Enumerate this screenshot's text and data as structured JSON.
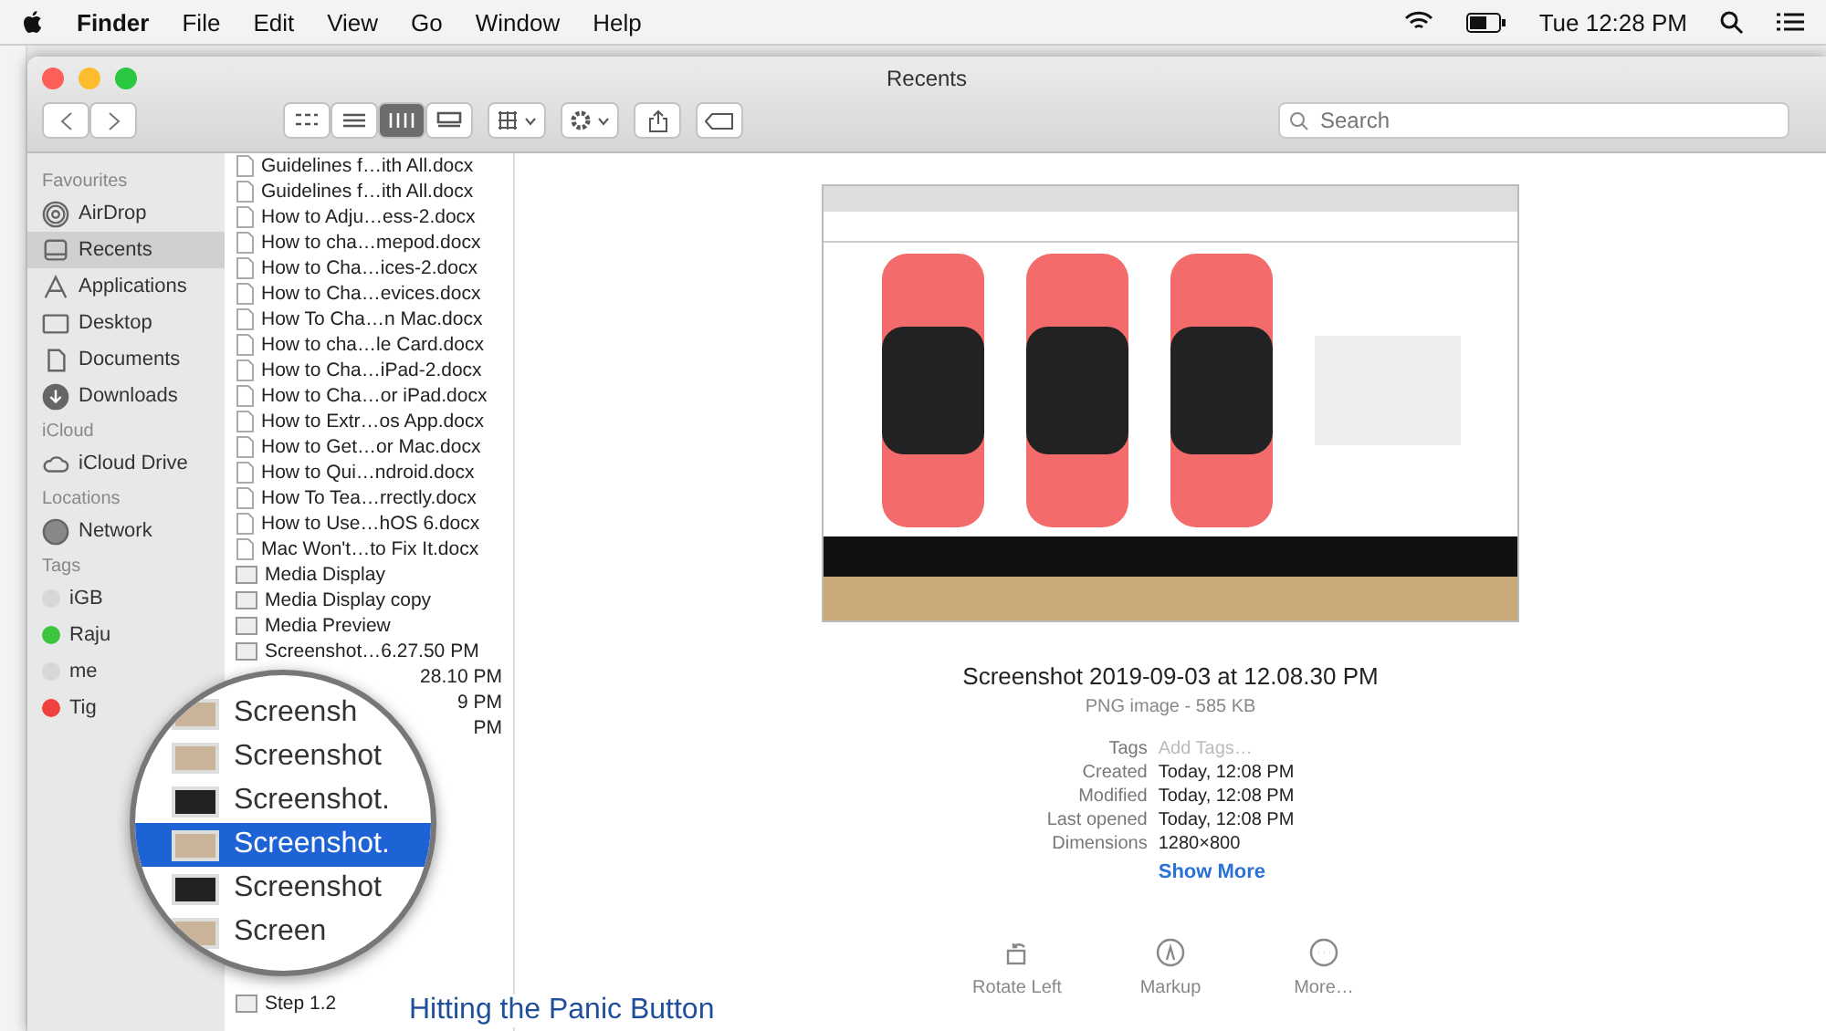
{
  "menubar": {
    "app": "Finder",
    "menus": [
      "File",
      "Edit",
      "View",
      "Go",
      "Window",
      "Help"
    ],
    "clock": "Tue 12:28 PM"
  },
  "window": {
    "title": "Recents",
    "search": {
      "placeholder": "Search"
    },
    "view_modes": [
      {
        "selected": false
      },
      {
        "selected": false
      },
      {
        "selected": true
      },
      {
        "selected": false
      }
    ]
  },
  "sidebar": [
    {
      "heading": "Favourites",
      "items": [
        {
          "label": "AirDrop",
          "kind": "airdrop",
          "selected": false
        },
        {
          "label": "Recents",
          "kind": "recents",
          "selected": true
        },
        {
          "label": "Applications",
          "kind": "apps",
          "selected": false
        },
        {
          "label": "Desktop",
          "kind": "desktop",
          "selected": false
        },
        {
          "label": "Documents",
          "kind": "documents",
          "selected": false
        },
        {
          "label": "Downloads",
          "kind": "downloads",
          "selected": false
        }
      ]
    },
    {
      "heading": "iCloud",
      "items": [
        {
          "label": "iCloud Drive",
          "kind": "cloud",
          "selected": false
        }
      ]
    },
    {
      "heading": "Locations",
      "items": [
        {
          "label": "Network",
          "kind": "network",
          "selected": false
        }
      ]
    },
    {
      "heading": "Tags",
      "items": [
        {
          "label": "iGB",
          "kind": "tag",
          "color": "#d8d8d8",
          "selected": false
        },
        {
          "label": "Raju",
          "kind": "tag",
          "color": "#3ec53e",
          "selected": false
        },
        {
          "label": "me",
          "kind": "tag",
          "color": "#d8d8d8",
          "selected": false
        },
        {
          "label": "Tig",
          "kind": "tag",
          "color": "#f04040",
          "selected": false
        }
      ]
    }
  ],
  "files": [
    {
      "name": "Guidelines f…ith All.docx",
      "kind": "doc"
    },
    {
      "name": "Guidelines f…ith All.docx",
      "kind": "doc"
    },
    {
      "name": "How to Adju…ess-2.docx",
      "kind": "doc"
    },
    {
      "name": "How to cha…mepod.docx",
      "kind": "doc"
    },
    {
      "name": "How to Cha…ices-2.docx",
      "kind": "doc"
    },
    {
      "name": "How to Cha…evices.docx",
      "kind": "doc"
    },
    {
      "name": "How To Cha…n Mac.docx",
      "kind": "doc"
    },
    {
      "name": "How to cha…le Card.docx",
      "kind": "doc"
    },
    {
      "name": "How to Cha…iPad-2.docx",
      "kind": "doc"
    },
    {
      "name": "How to Cha…or iPad.docx",
      "kind": "doc"
    },
    {
      "name": "How to Extr…os App.docx",
      "kind": "doc"
    },
    {
      "name": "How to Get…or Mac.docx",
      "kind": "doc"
    },
    {
      "name": "How to Qui…ndroid.docx",
      "kind": "doc"
    },
    {
      "name": "How To Tea…rrectly.docx",
      "kind": "doc"
    },
    {
      "name": "How to Use…hOS 6.docx",
      "kind": "doc"
    },
    {
      "name": "Mac Won't…to Fix It.docx",
      "kind": "doc"
    },
    {
      "name": "Media Display",
      "kind": "image"
    },
    {
      "name": "Media Display copy",
      "kind": "image"
    },
    {
      "name": "Media Preview",
      "kind": "image"
    },
    {
      "name": "Screenshot…6.27.50 PM",
      "kind": "image"
    },
    {
      "name": "28.10 PM",
      "kind": "fragment"
    },
    {
      "name": "9 PM",
      "kind": "fragment"
    },
    {
      "name": "PM",
      "kind": "fragment"
    },
    {
      "name": "Step 1.2",
      "kind": "last"
    }
  ],
  "magnifier": [
    {
      "label": "Screensh",
      "kind": "light",
      "selected": false
    },
    {
      "label": "Screenshot",
      "kind": "light",
      "selected": false
    },
    {
      "label": "Screenshot.",
      "kind": "dark",
      "selected": false
    },
    {
      "label": "Screenshot.",
      "kind": "light",
      "selected": true
    },
    {
      "label": "Screenshot",
      "kind": "dark",
      "selected": false
    },
    {
      "label": "Screen",
      "kind": "light",
      "selected": false
    }
  ],
  "preview": {
    "name": "Screenshot 2019-09-03 at 12.08.30 PM",
    "subtitle": "PNG image - 585 KB",
    "info": [
      {
        "label": "Tags",
        "placeholder": "Add Tags…"
      },
      {
        "label": "Created",
        "value": "Today, 12:08 PM"
      },
      {
        "label": "Modified",
        "value": "Today, 12:08 PM"
      },
      {
        "label": "Last opened",
        "value": "Today, 12:08 PM"
      },
      {
        "label": "Dimensions",
        "value": "1280×800"
      }
    ],
    "show_more": "Show More",
    "actions": [
      {
        "label": "Rotate Left",
        "kind": "rotate"
      },
      {
        "label": "Markup",
        "kind": "markup"
      },
      {
        "label": "More…",
        "kind": "more"
      }
    ]
  },
  "background_doc": {
    "heading": "Hitting the Panic Button"
  }
}
